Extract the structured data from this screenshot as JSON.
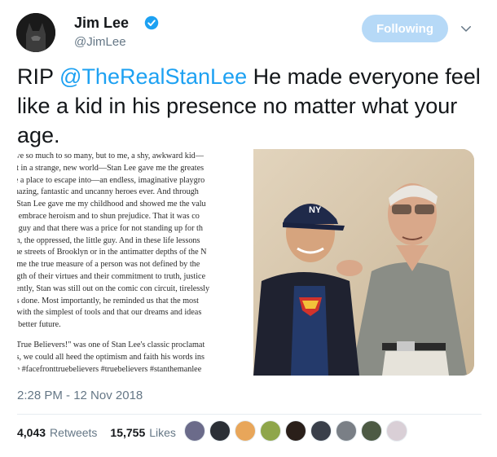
{
  "author": {
    "name": "Jim Lee",
    "handle": "@JimLee",
    "verified": true
  },
  "follow_button": {
    "label": "Following",
    "color": "#b6d9f7"
  },
  "tweet": {
    "prefix": "RIP ",
    "mention": "@TheRealStanLee",
    "body": " He made everyone feel like a kid in his presence no matter what your age.",
    "mention_color": "#1da1f2"
  },
  "media": {
    "letter_lines": [
      "ave so much to so many, but to me, a shy, awkward kid—",
      "nt in a strange, new world—Stan Lee gave me the greates",
      "ie a place to escape into—an endless, imaginative playgro",
      "mazing, fantastic and uncanny heroes ever.  And through",
      ", Stan Lee gave me my childhood and showed me the valu",
      "o embrace heroism and to shun prejudice.  That it was co",
      "d guy and that there was a price for not standing up for th",
      "en, the oppressed, the little guy.  And in these life lessons",
      " the streets of Brooklyn or in the antimatter depths of the N",
      "t me the true measure of a person was not defined by the",
      "ngth of their virtues and their commitment to truth, justice",
      "cently, Stan was still out on the comic con circuit, tirelessly",
      "t's done.  Most importantly, he reminded us that the most",
      "l with the simplest of tools and that our dreams and ideas",
      " a better future."
    ],
    "letter_lines_2": [
      ", True Believers!\" was one of Stan Lee's classic proclamat",
      "es, we could all heed the optimism and faith his words ins",
      "ee #facefronttruebelievers #truebelievers #stanthemanlee"
    ]
  },
  "timestamp": "2:28 PM - 12 Nov 2018",
  "stats": {
    "retweets_count": "4,043",
    "retweets_label": "Retweets",
    "likes_count": "15,755",
    "likes_label": "Likes"
  },
  "liker_avatars": [
    {
      "name": "liker-avatar-1",
      "color": "#6b6b8a"
    },
    {
      "name": "liker-avatar-2",
      "color": "#2b2f36"
    },
    {
      "name": "liker-avatar-3",
      "color": "#e8a65a"
    },
    {
      "name": "liker-avatar-4",
      "color": "#8fa64a"
    },
    {
      "name": "liker-avatar-5",
      "color": "#2a1f1a"
    },
    {
      "name": "liker-avatar-6",
      "color": "#3a3f4a"
    },
    {
      "name": "liker-avatar-7",
      "color": "#7a7f86"
    },
    {
      "name": "liker-avatar-8",
      "color": "#4d5a44"
    },
    {
      "name": "liker-avatar-9",
      "color": "#d9cfd6"
    }
  ]
}
